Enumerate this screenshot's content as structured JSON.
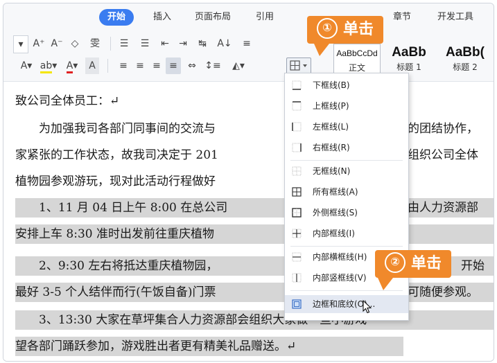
{
  "ribbon": {
    "tabs": [
      "开始",
      "插入",
      "页面布局",
      "引用",
      "章节",
      "开发工具"
    ],
    "font_row": [
      "A⁺",
      "A⁻",
      "◇",
      "雯",
      "☰",
      "☰",
      "⇤",
      "⇥",
      "↹",
      "A↓",
      "≡"
    ],
    "styles": [
      {
        "preview": "AaBbCcDd",
        "label": "正文"
      },
      {
        "preview": "AaBb",
        "label": "标题 1"
      },
      {
        "preview": "AaBb(",
        "label": "标题 2"
      }
    ]
  },
  "document": {
    "lines": [
      "致公司全体员工：↵",
      "　　为加强我司各部门同事间的交流与",
      "家紧张的工作状态，故我司决定于 201",
      "植物园参观游玩，现对此活动行程做好",
      "　　1、11 月 04 日上午 8:00 在总公司",
      "安排上车 8:30 准时出发前往重庆植物",
      "　　2、9:30 左右将抵达重庆植物园，",
      "最好 3-5 个人结伴而行(午饭自备)门票",
      "　　3、13:30 大家在草坪集合人力资源部会组织大家做一些小游戏",
      "望各部门踊跃参加，游戏胜出者更有精美礼品赠送。↵"
    ],
    "right_fragments": [
      "的团结协作，",
      "组织公司全体",
      "由人力资源部",
      "开始",
      "可随便参观。"
    ]
  },
  "border_menu": {
    "items": [
      {
        "label": "下框线(B)",
        "icon": "bottom-border-icon"
      },
      {
        "label": "上框线(P)",
        "icon": "top-border-icon"
      },
      {
        "label": "左框线(L)",
        "icon": "left-border-icon"
      },
      {
        "label": "右框线(R)",
        "icon": "right-border-icon"
      },
      {
        "label": "无框线(N)",
        "icon": "no-border-icon"
      },
      {
        "label": "所有框线(A)",
        "icon": "all-borders-icon"
      },
      {
        "label": "外侧框线(S)",
        "icon": "outside-borders-icon"
      },
      {
        "label": "内部框线(I)",
        "icon": "inside-borders-icon"
      },
      {
        "label": "内部横框线(H)",
        "icon": "inside-horizontal-border-icon"
      },
      {
        "label": "内部竖框线(V)",
        "icon": "inside-vertical-border-icon"
      },
      {
        "label": "边框和底纹(O)...",
        "icon": "borders-shading-icon"
      }
    ]
  },
  "callouts": {
    "step1": {
      "number": "①",
      "text": "单击"
    },
    "step2": {
      "number": "②",
      "text": "单击"
    }
  },
  "colors": {
    "accent": "#3a7cf0",
    "callout": "#f0892b",
    "shading": "#d6d6d6"
  }
}
